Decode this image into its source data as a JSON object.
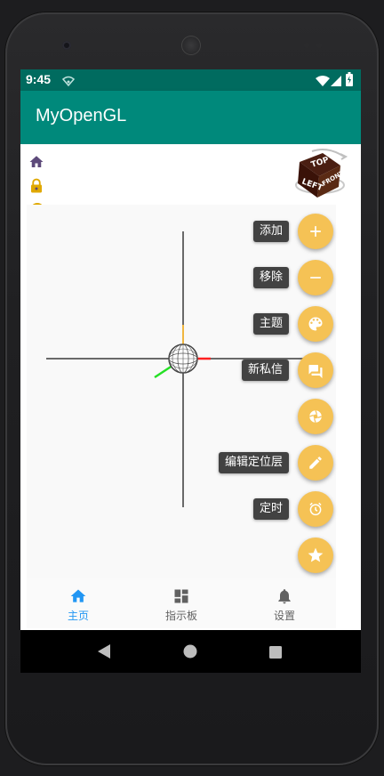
{
  "status_bar": {
    "time": "9:45"
  },
  "app_bar": {
    "title": "MyOpenGL"
  },
  "fab_menu": [
    {
      "label": "添加",
      "icon": "plus-icon"
    },
    {
      "label": "移除",
      "icon": "minus-icon"
    },
    {
      "label": "主题",
      "icon": "palette-icon"
    },
    {
      "label": "新私信",
      "icon": "chat-icon"
    },
    {
      "label": "",
      "icon": "camera-iris-icon"
    },
    {
      "label": "编辑定位层",
      "icon": "pencil-icon"
    },
    {
      "label": "定时",
      "icon": "alarm-icon"
    },
    {
      "label": "",
      "icon": "star-icon"
    }
  ],
  "bottom_nav": {
    "items": [
      {
        "label": "主页",
        "icon": "home-icon",
        "active": true
      },
      {
        "label": "指示板",
        "icon": "dashboard-icon",
        "active": false
      },
      {
        "label": "设置",
        "icon": "bell-icon",
        "active": false
      }
    ]
  },
  "colors": {
    "status_bar": "#006b5f",
    "app_bar": "#00897b",
    "fab": "#f5c255",
    "label_bg": "#424242",
    "nav_active": "#2196f3",
    "tool_icon": "#e0a800"
  }
}
